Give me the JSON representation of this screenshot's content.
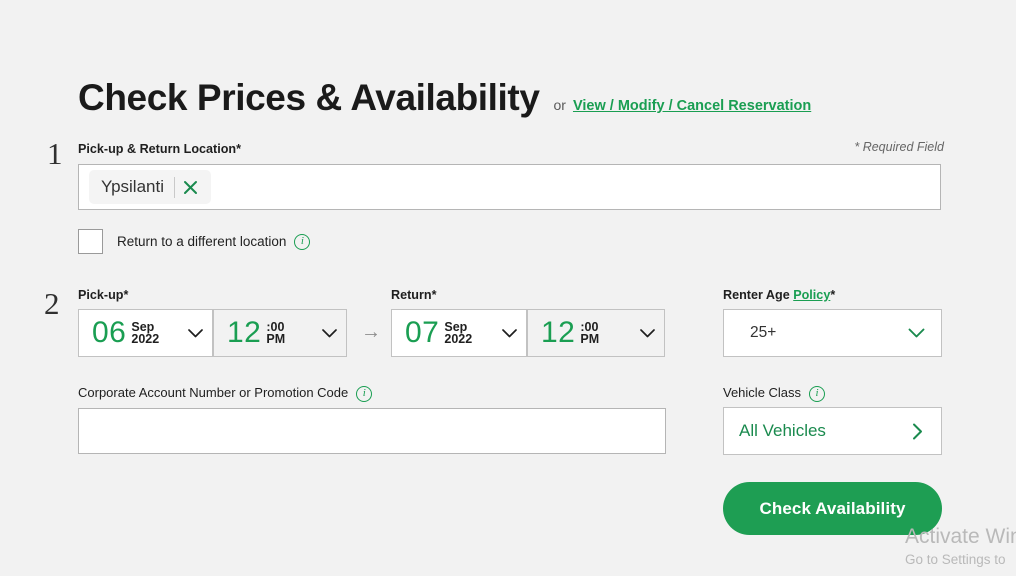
{
  "header": {
    "title": "Check Prices & Availability",
    "or_text": "or",
    "modify_link": "View / Modify / Cancel Reservation"
  },
  "required_note": "* Required Field",
  "steps": {
    "one": "1",
    "two": "2"
  },
  "location": {
    "label": "Pick-up & Return Location*",
    "chip_text": "Ypsilanti",
    "clear_icon": "close-icon",
    "return_different_label": "Return to a different location",
    "info_icon": "info-icon",
    "checkbox_checked": false
  },
  "pickup": {
    "label": "Pick-up*",
    "day": "06",
    "month": "Sep",
    "year": "2022",
    "hour": "12",
    "minutes": ":00",
    "meridiem": "PM"
  },
  "separator_arrow": "→",
  "return": {
    "label": "Return*",
    "day": "07",
    "month": "Sep",
    "year": "2022",
    "hour": "12",
    "minutes": ":00",
    "meridiem": "PM"
  },
  "corporate": {
    "label": "Corporate Account Number or Promotion Code",
    "value": "",
    "placeholder": ""
  },
  "renter_age": {
    "label_prefix": "Renter Age",
    "policy_link": "Policy",
    "label_suffix": "*",
    "value": "25+",
    "options": [
      "25+"
    ]
  },
  "vehicle_class": {
    "label": "Vehicle Class",
    "value": "All Vehicles"
  },
  "submit": {
    "label": "Check Availability"
  },
  "watermark": {
    "title": "Activate Win",
    "subtitle": "Go to Settings to"
  },
  "colors": {
    "brand_green": "#1e9e53",
    "link_green": "#1a9e52",
    "page_bg": "#f2f2f2",
    "field_border": "#c2c2c2"
  }
}
